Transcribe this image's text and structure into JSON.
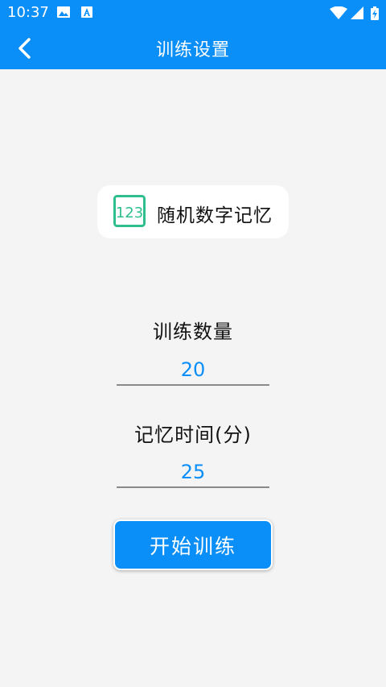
{
  "status_bar": {
    "time": "10:37",
    "icons": [
      "image-icon",
      "a-icon",
      "wifi-icon",
      "signal-icon",
      "battery-icon"
    ]
  },
  "toolbar": {
    "title": "训练设置",
    "back_icon": "chevron-left-icon"
  },
  "mode": {
    "icon_text": "123",
    "label": "随机数字记忆"
  },
  "form": {
    "count_label": "训练数量",
    "count_value": "20",
    "time_label": "记忆时间(分)",
    "time_value": "25"
  },
  "start_button": {
    "label": "开始训练"
  },
  "colors": {
    "primary": "#0a8ef7",
    "background": "#f4f4f4",
    "icon_green": "#2fbf8f"
  }
}
